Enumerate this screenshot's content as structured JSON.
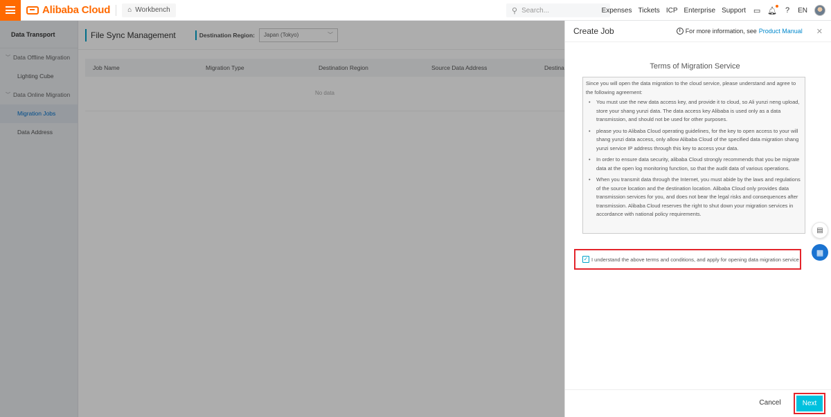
{
  "header": {
    "brand": "Alibaba Cloud",
    "workbench_label": "Workbench",
    "search_placeholder": "Search...",
    "nav": [
      "Expenses",
      "Tickets",
      "ICP",
      "Enterprise",
      "Support"
    ],
    "language": "EN"
  },
  "sidebar": {
    "title": "Data Transport",
    "groups": [
      {
        "label": "Data Offline Migration",
        "items": [
          "Lighting Cube"
        ]
      },
      {
        "label": "Data Online Migration",
        "items": [
          "Migration Jobs",
          "Data Address"
        ]
      }
    ],
    "active_item": "Migration Jobs"
  },
  "main": {
    "title": "File Sync Management",
    "region_label": "Destination Region:",
    "region_value": "Japan (Tokyo)",
    "columns": [
      "Job Name",
      "Migration Type",
      "Destination Region",
      "Source Data Address",
      "Destinat"
    ],
    "empty_text": "No data"
  },
  "drawer": {
    "title": "Create Job",
    "info_text": "For more information, see",
    "info_link": "Product Manual",
    "terms_title": "Terms of Migration Service",
    "terms_intro": "Since you will open the data migration to the cloud service, please understand and agree to the following agreement:",
    "terms_items": [
      "You must use the new data access key, and provide it to cloud, so Ali yunzi neng upload, store your shang yunzi data. The data access key Alibaba is used only as a data transmission, and should not be used for other purposes.",
      "please you to Alibaba Cloud operating guidelines, for the key to open access to your will shang yunzi data access, only allow Alibaba Cloud of the specified data migration shang yunzi service IP address through this key to access your data.",
      "In order to ensure data security, alibaba Cloud strongly recommends that you be migrate data at the open log monitoring function, so that the audit data of various operations.",
      "When you transmit data through the Internet, you must abide by the laws and regulations of the source location and the destination location. Alibaba Cloud only provides data transmission services for you, and does not bear the legal risks and consequences after transmission. Alibaba Cloud reserves the right to shut down your migration services in accordance with national policy requirements."
    ],
    "agree_text": "I understand the above terms and conditions, and apply for opening data migration service",
    "agree_checked": true,
    "cancel_label": "Cancel",
    "next_label": "Next"
  },
  "colors": {
    "brand_orange": "#ff6a00",
    "accent_cyan": "#00c1de",
    "highlight_red": "#e4242b",
    "link_blue": "#0088cc"
  }
}
